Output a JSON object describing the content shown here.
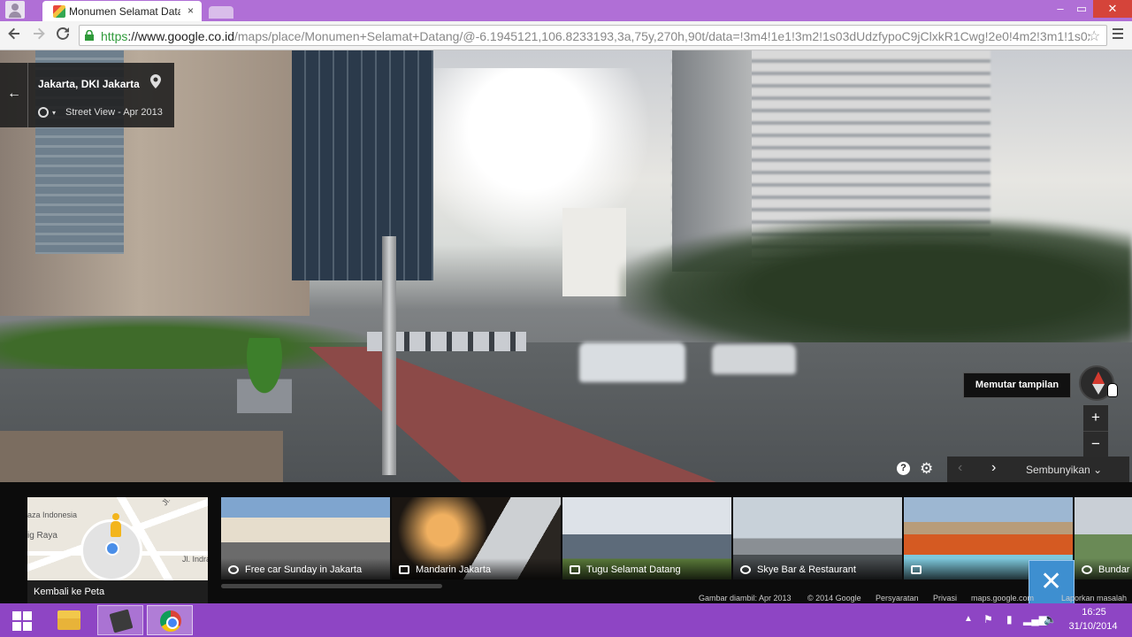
{
  "browser": {
    "tab_title": "Monumen Selamat Datan",
    "tab_close": "×",
    "url_scheme": "https",
    "url_host": "://www.google.co.id",
    "url_path": "/maps/place/Monumen+Selamat+Datang/@-6.1945121,106.8233193,3a,75y,270h,90t/data=!3m4!1e1!3m2!1s03dUdzfypoC9jClxkR1Cwg!2e0!4m2!3m1!1s0x2e69f4",
    "window_min": "–",
    "window_max": "▭",
    "window_close": "✕",
    "icons": [
      "user-icon",
      "back-icon",
      "forward-icon",
      "reload-icon",
      "lock-icon",
      "star-icon",
      "menu-icon"
    ]
  },
  "streetview": {
    "location": "Jakarta, DKI Jakarta",
    "date_label": "Street View - Apr 2013",
    "tooltip": "Memutar tampilan",
    "zoom_in": "+",
    "zoom_out": "−",
    "help": "?",
    "hide_label": "Sembunyikan",
    "nav_prev": "‹",
    "nav_next": "›",
    "caret": "▾",
    "back": "←",
    "settings": "⚙",
    "hide_chevron": "⌄"
  },
  "minimap": {
    "label_1": "aza Indonesia",
    "label_2": "ig Raya",
    "label_3": "Jl. Yusuf Ad",
    "label_4": "Jl. Indramay",
    "back_to_map": "Kembali ke Peta"
  },
  "thumbnails": [
    {
      "label": "Free car Sunday in Jakarta",
      "icon": "street-view-icon"
    },
    {
      "label": "Mandarin Jakarta",
      "icon": "camera-icon"
    },
    {
      "label": "Tugu Selamat Datang",
      "icon": "camera-icon"
    },
    {
      "label": "Skye Bar & Restaurant",
      "icon": "street-view-icon"
    },
    {
      "label": "",
      "icon": "camera-icon"
    },
    {
      "label": "Bundar",
      "icon": "street-view-icon"
    }
  ],
  "footer": {
    "image_date": "Gambar diambil: Apr 2013",
    "copyright": "© 2014 Google",
    "terms": "Persyaratan",
    "privacy": "Privasi",
    "domain": "maps.google.com",
    "report": "Laporkan masalah"
  },
  "taskbar": {
    "time": "16:25",
    "date": "31/10/2014",
    "tray_up": "▲",
    "tray_flag": "⚑",
    "tray_battery": "▮",
    "tray_signal": "▂▄▆",
    "tray_volume": "🔈"
  },
  "colors": {
    "titlebar": "#b06fd6",
    "taskbar": "#8e45c4",
    "close_button": "#d5443a",
    "https_green": "#2f9a3a"
  }
}
